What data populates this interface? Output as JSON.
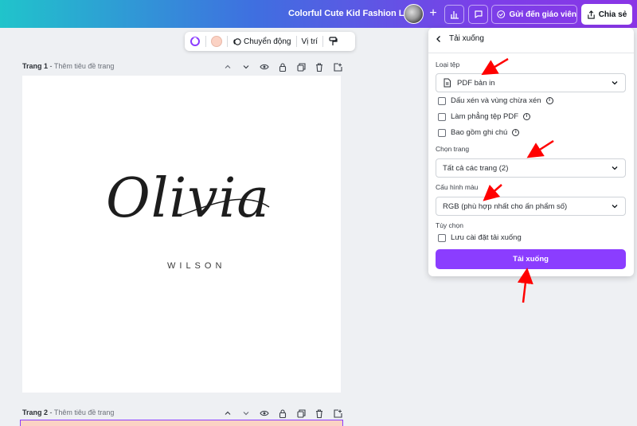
{
  "topbar": {
    "doc_title": "Colorful Cute Kid Fashion Logo",
    "send_label": "Gửi đến giáo viên",
    "share_label": "Chia sẻ"
  },
  "context_toolbar": {
    "animate_label": "Chuyển động",
    "position_label": "Vị trí",
    "swatch_color": "#fbd2c4"
  },
  "pages": [
    {
      "label": "Trang 1",
      "subtitle": "Thêm tiêu đề trang"
    },
    {
      "label": "Trang 2",
      "subtitle": "Thêm tiêu đề trang"
    }
  ],
  "design": {
    "script_text": "Olivia",
    "sub_text": "WILSON"
  },
  "download_panel": {
    "title": "Tải xuống",
    "file_type_label": "Loại tệp",
    "file_type_value": "PDF bản in",
    "options": [
      {
        "label": "Dấu xén và vùng chừa xén",
        "checked": false
      },
      {
        "label": "Làm phẳng tệp PDF",
        "checked": false
      },
      {
        "label": "Bao gồm ghi chú",
        "checked": false
      }
    ],
    "page_select_label": "Chọn trang",
    "page_select_value": "Tất cả các trang (2)",
    "color_profile_label": "Cấu hình màu",
    "color_profile_value": "RGB (phù hợp nhất cho ấn phẩm số)",
    "preferences_label": "Tùy chọn",
    "save_settings_label": "Lưu cài đặt tải xuống",
    "download_button": "Tải xuống"
  },
  "colors": {
    "accent": "#8b3dff",
    "annotation_arrow": "#ff0000"
  }
}
